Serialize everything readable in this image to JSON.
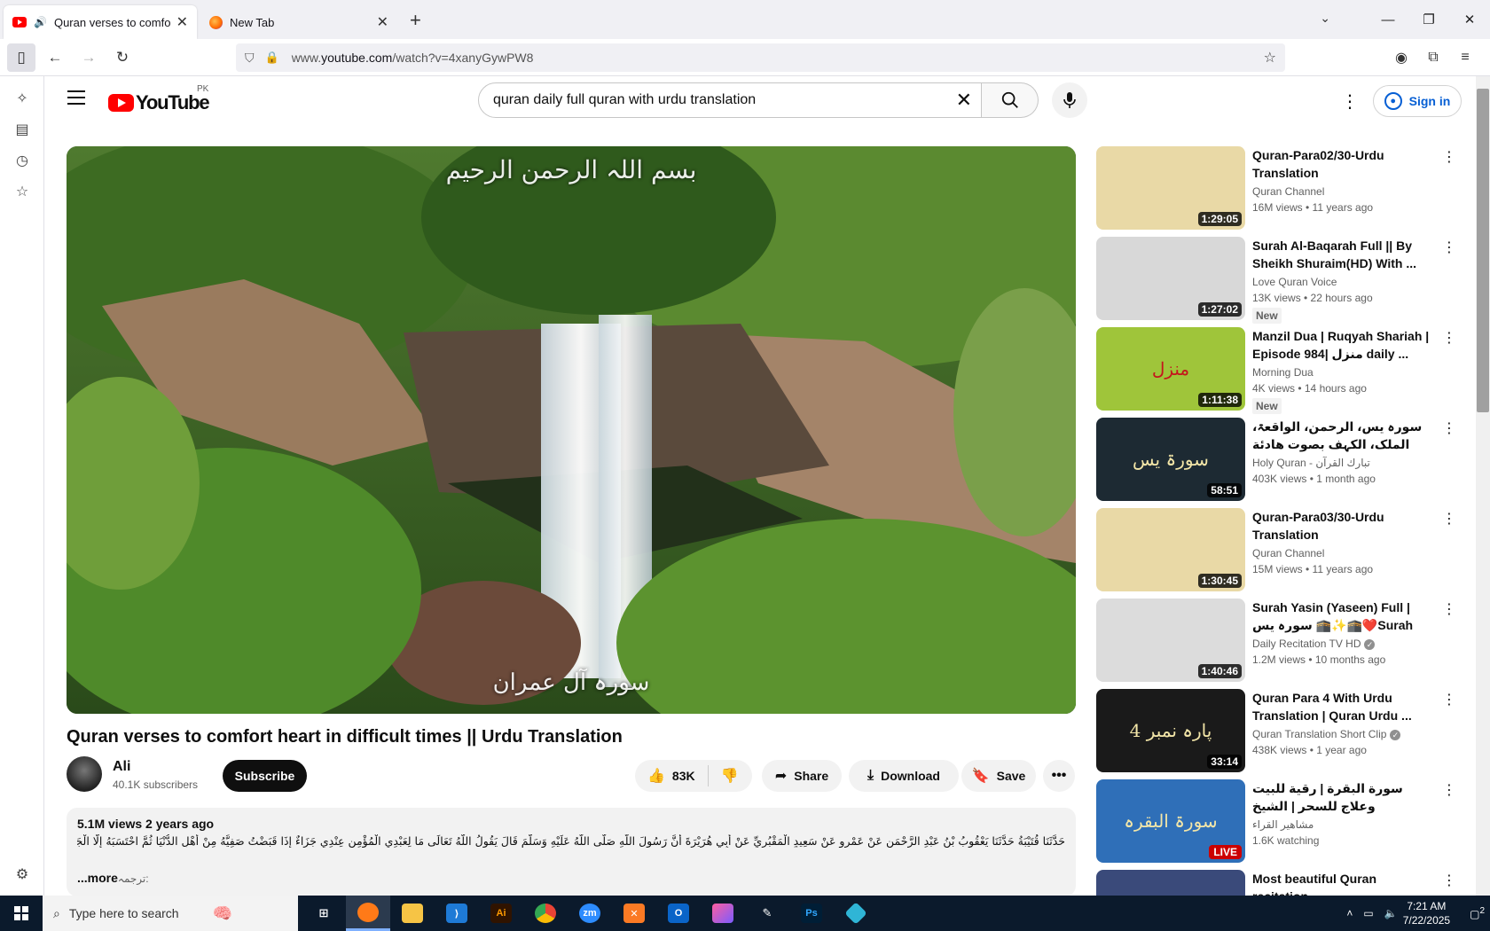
{
  "browser": {
    "tabs": [
      {
        "title": "Quran verses to comfort he",
        "active": true
      },
      {
        "title": "New Tab",
        "active": false
      }
    ],
    "url_prefix": "www.",
    "url_domain": "youtube.com",
    "url_path": "/watch?v=4xanyGywPW8"
  },
  "youtube": {
    "logo_word": "YouTube",
    "country": "PK",
    "search_query": "quran daily full quran with urdu translation",
    "signin_label": "Sign in"
  },
  "player": {
    "caption_top": "بسم اللہ الرحمن الرحیم",
    "caption_bottom": "سورہ آل عمران"
  },
  "video": {
    "title": "Quran verses to comfort heart in difficult times || Urdu Translation",
    "channel": "Ali",
    "subscribers": "40.1K subscribers",
    "subscribe_label": "Subscribe",
    "likes": "83K",
    "share_label": "Share",
    "download_label": "Download",
    "save_label": "Save",
    "stats": "5.1M views  2 years ago",
    "description_arabic": "حَدَّثَنَا قُتَيْبَةُ حَدَّثَنَا يَعْقُوبُ بْنُ عَبْدِ الرَّحْمَنِ عَنْ عَمْرٍو عَنْ سَعِيدٍ الْمَقْبُرِيِّ عَنْ أَبِي هُرَيْرَةَ أَنَّ رَسُولَ اللَّهِ صَلَّى اللَّهُ عَلَيْهِ وَسَلَّمَ قَالَ يَقُولُ اللَّهُ تَعَالَى مَا لِعَبْدِي الْمُؤْمِنِ عِنْدِي جَزَاءٌ إِذَا قَبَضْتُ صَفِيَّهُ مِنْ أَهْلِ الدُّنْيَا ثُمَّ احْتَسَبَهُ إِلَّا الْجَنَّةُ",
    "description_urdu": "ترجمہ:",
    "more_label": "...more"
  },
  "recommendations": [
    {
      "title": "Quran-Para02/30-Urdu Translation",
      "channel": "Quran Channel",
      "meta": "16M views • 11 years ago",
      "duration": "1:29:05",
      "new": false,
      "verified": false,
      "thumb_text": "",
      "thumb_color": "#e9d9a6"
    },
    {
      "title": "Surah Al-Baqarah Full || By Sheikh Shuraim(HD) With ...",
      "channel": "Love Quran Voice",
      "meta": "13K views • 22 hours ago",
      "duration": "1:27:02",
      "new": true,
      "verified": false,
      "thumb_text": "",
      "thumb_color": "#d8d8d8"
    },
    {
      "title": "Manzil Dua | Ruqyah Shariah | Episode 984| منزل daily ...",
      "channel": "Morning Dua",
      "meta": "4K views • 14 hours ago",
      "duration": "1:11:38",
      "new": true,
      "verified": false,
      "thumb_text": "منزل",
      "thumb_color": "#9fc53a"
    },
    {
      "title": "سورہ یس، الرحمن، الواقعۃ، الملک، الکہف بصوت هادئة للشيخ عبد الرحمن السديس، استمع",
      "channel": "Holy Quran - تبارك القرآن",
      "meta": "403K views • 1 month ago",
      "duration": "58:51",
      "new": false,
      "verified": false,
      "thumb_text": "سورۃ یس",
      "thumb_color": "#1d2a33"
    },
    {
      "title": "Quran-Para03/30-Urdu Translation",
      "channel": "Quran Channel",
      "meta": "15M views • 11 years ago",
      "duration": "1:30:45",
      "new": false,
      "verified": false,
      "thumb_text": "",
      "thumb_color": "#e9d9a6"
    },
    {
      "title": "Surah Yasin (Yaseen) Full | سورہ یس 🕋✨🕋❤️Surah Yasin Fu...",
      "channel": "Daily Recitation TV HD",
      "meta": "1.2M views • 10 months ago",
      "duration": "1:40:46",
      "new": false,
      "verified": true,
      "thumb_text": "",
      "thumb_color": "#dcdcdc"
    },
    {
      "title": "Quran Para 4 With Urdu Translation | Quran Urdu ...",
      "channel": "Quran Translation Short Clip",
      "meta": "438K views • 1 year ago",
      "duration": "33:14",
      "new": false,
      "verified": true,
      "thumb_text": "پارہ نمبر 4",
      "thumb_color": "#1a1a1a"
    },
    {
      "title": "سورة البقرة | رقية للبيت وعلاج للسحر | الشيخ عبدالباسط عبدالصمد Surah Al ...",
      "channel": "مشاهير القراء",
      "meta": "1.6K watching",
      "duration": "",
      "live": "LIVE",
      "new": false,
      "verified": false,
      "thumb_text": "سورۃ البقرہ",
      "thumb_color": "#2f6fb8"
    },
    {
      "title": "Most beautiful Quran recitation",
      "channel": "",
      "meta": "",
      "duration": "",
      "new": false,
      "verified": false,
      "thumb_text": "",
      "thumb_color": "#3a4a7a"
    }
  ],
  "rec_new_label": "New",
  "taskbar": {
    "search_placeholder": "Type here to search",
    "apps": [
      "Ai",
      "zm",
      "Ps"
    ],
    "time": "7:21 AM",
    "date": "7/22/2025",
    "notifications": "2"
  }
}
